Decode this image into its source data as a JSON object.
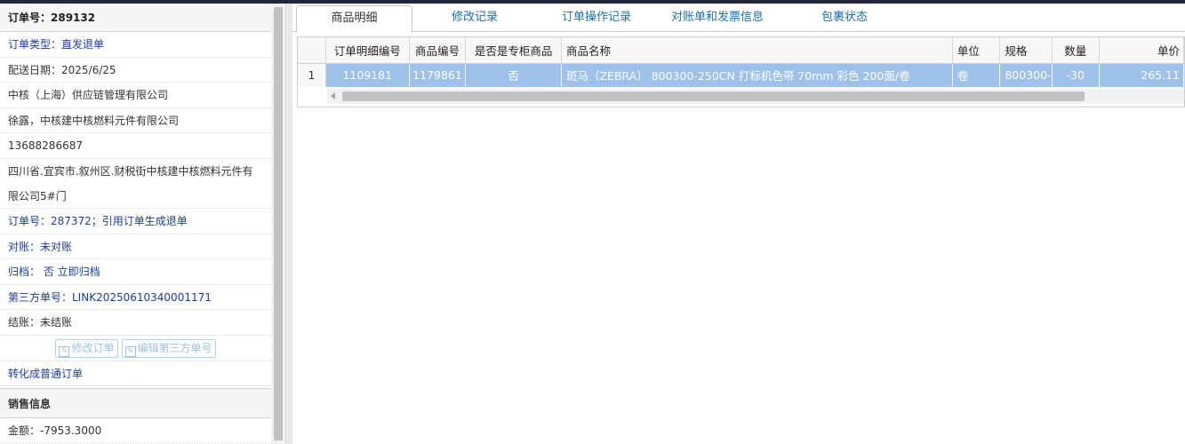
{
  "left": {
    "order_no_title": "订单号：289132",
    "order_type": "订单类型：直发退单",
    "delivery_date": "配送日期：2025/6/25",
    "company": "中核（上海）供应链管理有限公司",
    "contact": "徐露，中核建中核燃料元件有限公司",
    "phone": "13688286687",
    "address": "四川省.宜宾市.叙州区.财税街中核建中核燃料元件有限公司5#门",
    "ref_order": "订单号：287372；引用订单生成退单",
    "reconcile": "对账：未对账",
    "archive": "归档： 否 立即归档",
    "third_party": "第三方单号：LINK20250610340001171",
    "settle": "结账：未结账",
    "btn_edit_order": "修改订单",
    "btn_edit_third": "编辑第三方单号",
    "convert": "转化成普通订单",
    "sales_title": "销售信息",
    "amount": "金额：-7953.3000"
  },
  "tabs": [
    "商品明细",
    "修改记录",
    "订单操作记录",
    "对账单和发票信息",
    "包裹状态"
  ],
  "grid": {
    "headers": [
      "订单明细编号",
      "商品编号",
      "是否是专柜商品",
      "商品名称",
      "单位",
      "规格",
      "数量",
      "单价"
    ],
    "rows": [
      {
        "rn": "1",
        "detail_no": "1109181",
        "product_no": "1179861",
        "counter": "否",
        "name": "斑马（ZEBRA） 800300-250CN 打标机色带 70mm 彩色 200面/卷",
        "unit": "卷",
        "spec": "800300-",
        "qty": "-30",
        "price": "265.11"
      }
    ]
  },
  "colors": {
    "accent": "#1a3cab",
    "selected_row": "#9ec1ec",
    "tab_link": "#1a6fb0"
  }
}
